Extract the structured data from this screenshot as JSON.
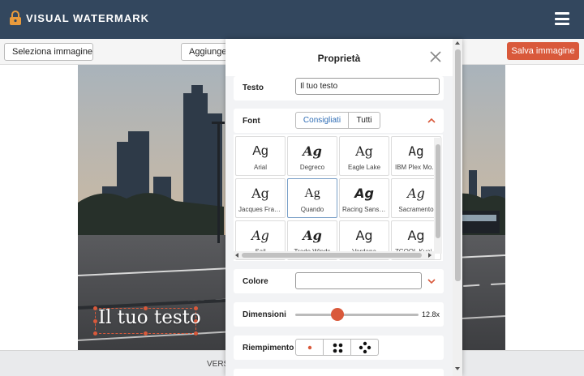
{
  "app": {
    "title": "VISUAL WATERMARK",
    "colors": {
      "header": "#33475e",
      "accent": "#d9593b",
      "link": "#2f6db5"
    }
  },
  "toolbar": {
    "select_image": "Seleziona immagine",
    "add_label": "Aggiungere",
    "save_image": "Salva immagine"
  },
  "watermark": {
    "text": "Il tuo testo"
  },
  "footer": {
    "version_text": "VERSI"
  },
  "panel": {
    "title": "Proprietà",
    "text_label": "Testo",
    "text_value": "Il tuo testo",
    "font_label": "Font",
    "font_tabs": {
      "recommended": "Consigliati",
      "all": "Tutti",
      "active": "recommended"
    },
    "font_sample": "Ag",
    "fonts": [
      {
        "name": "Arial",
        "selected": false
      },
      {
        "name": "Degreco",
        "selected": false
      },
      {
        "name": "Eagle Lake",
        "selected": false
      },
      {
        "name": "IBM Plex Mo...",
        "selected": false
      },
      {
        "name": "Jacques Fran...",
        "selected": false
      },
      {
        "name": "Quando",
        "selected": true
      },
      {
        "name": "Racing Sans ...",
        "selected": false
      },
      {
        "name": "Sacramento",
        "selected": false
      },
      {
        "name": "Sail",
        "selected": false
      },
      {
        "name": "Trade Winds",
        "selected": false
      },
      {
        "name": "Verdana",
        "selected": false
      },
      {
        "name": "ZCOOL Kuai...",
        "selected": false
      }
    ],
    "color_label": "Colore",
    "size_label": "Dimensioni",
    "size_value": "12.8x",
    "size_fraction": 0.34,
    "fill_label": "Riempimento",
    "fill_options": [
      "single-dot-icon",
      "four-dots-icon",
      "five-dots-icon"
    ]
  }
}
